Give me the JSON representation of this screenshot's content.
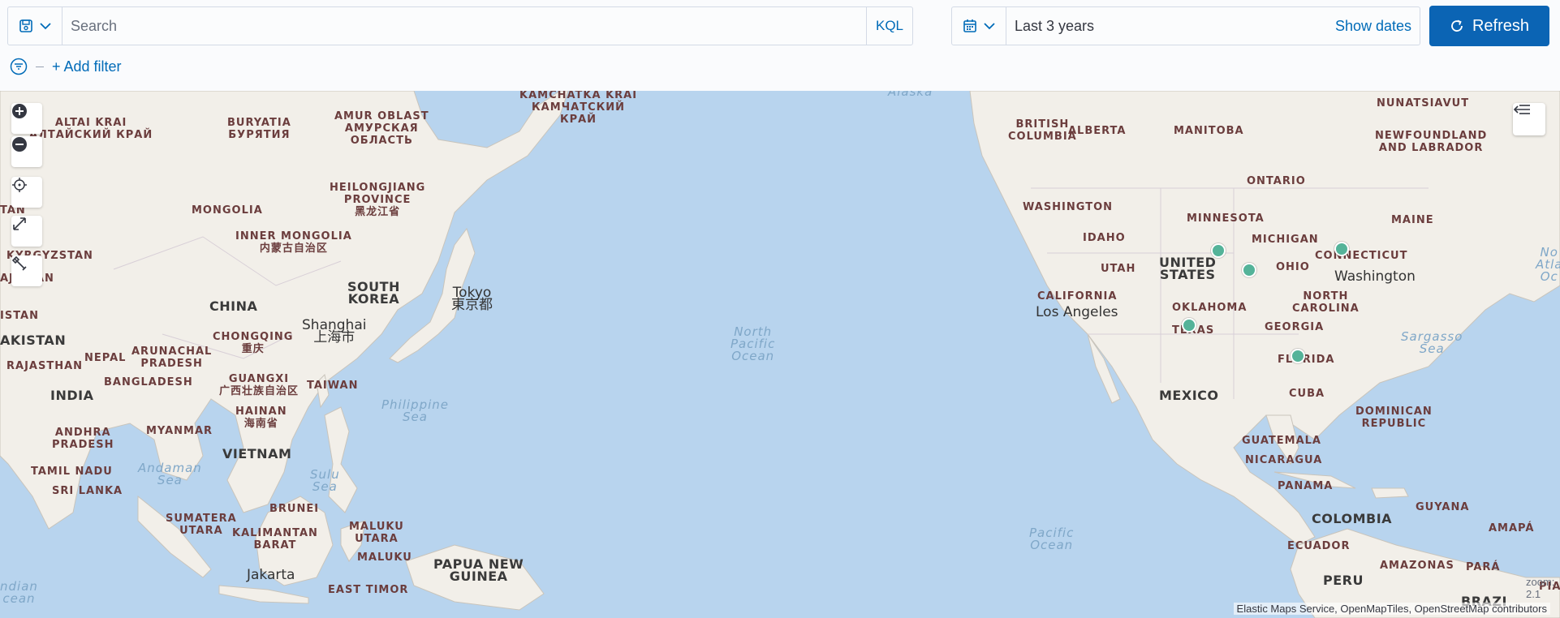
{
  "search": {
    "placeholder": "Search",
    "language": "KQL"
  },
  "time": {
    "range": "Last 3 years",
    "show_dates_label": "Show dates",
    "refresh_label": "Refresh"
  },
  "filters": {
    "add_filter_label": "+ Add filter"
  },
  "map": {
    "labels": {
      "altai": "ALTAI KRAI\nАЛТАЙСКИЙ КРАЙ",
      "buryatia": "BURYATIA\nБУРЯТИЯ",
      "amur": "AMUR OBLAST\nАМУРСКАЯ\nОБЛАСТЬ",
      "kamchatka": "KAMCHATKA KRAI\nКАМЧАТСКИЙ\nКРАЙ",
      "alaska": "Alaska",
      "heilongjiang": "HEILONGJIANG\nPROVINCE\n黑龙江省",
      "mongolia": "MONGOLIA",
      "inner_mongolia": "INNER MONGOLIA\n内蒙古自治区",
      "kyrgyzstan": "KYRGYZSTAN",
      "tan": "TAN",
      "aji": "AJI",
      "jan": "AN",
      "istan": "ISTAN",
      "china": "CHINA",
      "south_korea": "SOUTH\nKOREA",
      "tokyo": "Tokyo\n東京都",
      "shanghai": "Shanghai\n上海市",
      "chongqing": "CHONGQING\n重庆",
      "akistan": "AKISTAN",
      "nepal": "NEPAL",
      "arunachal": "ARUNACHAL\nPRADESH",
      "rajasthan": "RAJASTHAN",
      "bangladesh": "BANGLADESH",
      "guangxi": "GUANGXI\n广西壮族自治区",
      "taiwan": "TAIWAN",
      "india": "INDIA",
      "hainan": "HAINAN\n海南省",
      "philippine_sea": "Philippine\nSea",
      "myanmar": "MYANMAR",
      "andhra": "ANDHRA\nPRADESH",
      "vietnam": "VIETNAM",
      "tamil": "TAMIL NADU",
      "andaman": "Andaman\nSea",
      "sulu": "Sulu\nSea",
      "sri_lanka": "SRI LANKA",
      "brunei": "BRUNEI",
      "sumatera": "SUMATERA\nUTARA",
      "kalimantan": "KALIMANTAN\nBARAT",
      "maluku_utara": "MALUKU\nUTARA",
      "maluku": "MALUKU",
      "papua": "PAPUA NEW\nGUINEA",
      "jakarta": "Jakarta",
      "east_timor": "EAST TIMOR",
      "indian_ocean": "ndian\ncean",
      "north_pacific": "North\nPacific\nOcean",
      "pacific": "Pacific\nOcean",
      "bc": "BRITISH\nCOLUMBIA",
      "alberta": "ALBERTA",
      "manitoba": "MANITOBA",
      "nunatsiavut": "NUNATSIAVUT",
      "newfoundland": "NEWFOUNDLAND\nAND LABRADOR",
      "ontario": "ONTARIO",
      "washington_state": "WASHINGTON",
      "minnesota": "MINNESOTA",
      "maine": "MAINE",
      "idaho": "IDAHO",
      "michigan": "MICHIGAN",
      "connecticut": "CONNECTICUT",
      "utah": "UTAH",
      "united_states": "UNITED\nSTATES",
      "ohio": "OHIO",
      "washington_dc": "Washington",
      "no_atl": "No\nAtla\nOc",
      "california": "CALIFORNIA",
      "los_angeles": "Los Angeles",
      "north_carolina": "NORTH\nCAROLINA",
      "oklahoma": "OKLAHOMA",
      "texas": "TEXAS",
      "georgia": "GEORGIA",
      "sargasso": "Sargasso\nSea",
      "florida": "FLORIDA",
      "mexico": "MEXICO",
      "cuba": "CUBA",
      "dominican": "DOMINICAN\nREPUBLIC",
      "guatemala": "GUATEMALA",
      "nicaragua": "NICARAGUA",
      "panama": "PANAMA",
      "guyana": "GUYANA",
      "colombia": "COLOMBIA",
      "amapa": "AMAPÁ",
      "ecuador": "ECUADOR",
      "amazonas": "AMAZONAS",
      "para": "PARÁ",
      "peru": "PERU",
      "brazil": "BRAZI",
      "piaui": "PIAUI"
    },
    "zoom_text": "zoom: 2.1",
    "attribution": "Elastic Maps Service, OpenMapTiles, OpenStreetMap contributors",
    "marker_color": "#54b399",
    "ocean_color": "#b8d4ee",
    "land_color": "#f2efe9"
  },
  "icons": {
    "saved_query": "save-icon",
    "chevron": "chevron-down-icon",
    "calendar": "calendar-icon",
    "refresh": "refresh-icon",
    "filter": "filter-icon",
    "zoom_in": "plus-icon",
    "zoom_out": "minus-icon",
    "locate": "crosshair-icon",
    "fit": "expand-icon",
    "tools": "wrench-icon",
    "legend": "collapse-left-icon"
  }
}
